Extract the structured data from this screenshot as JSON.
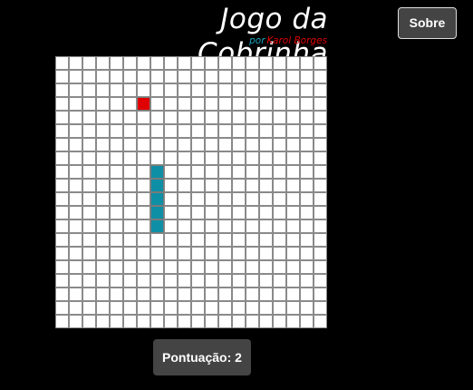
{
  "header": {
    "title": "Jogo da Cobrinha",
    "byline_prefix": "por",
    "byline_author": "Karol Borges"
  },
  "about_button": {
    "label": "Sobre"
  },
  "board": {
    "columns": 20,
    "rows": 20,
    "snake": [
      {
        "col": 7,
        "row": 8
      },
      {
        "col": 7,
        "row": 9
      },
      {
        "col": 7,
        "row": 10
      },
      {
        "col": 7,
        "row": 11
      },
      {
        "col": 7,
        "row": 12
      }
    ],
    "food": {
      "col": 6,
      "row": 3
    }
  },
  "score": {
    "label": "Pontuação:",
    "value": "2"
  },
  "colors": {
    "snake": "#0f8fa6",
    "food": "#e00000",
    "byline_prefix": "#1aa3c0",
    "byline_author": "#e00000"
  }
}
